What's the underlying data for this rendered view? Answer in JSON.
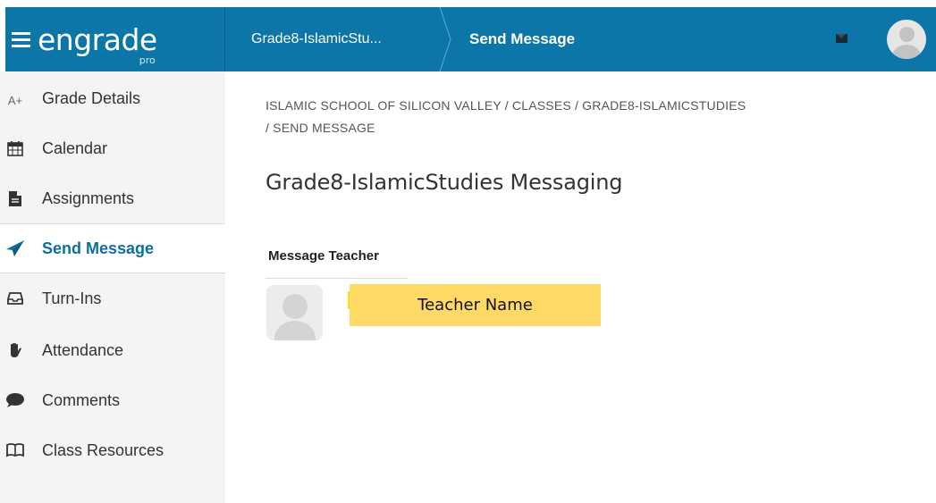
{
  "app": {
    "logo": "engrade",
    "logo_sub": "pro"
  },
  "header": {
    "crumbs": [
      "Grade8-IslamicStu...",
      "Send Message"
    ],
    "icons": {
      "mail": "mail-icon",
      "avatar": "user-avatar-icon"
    },
    "colors": {
      "bar": "#0d76a8"
    }
  },
  "sidebar": {
    "items": [
      {
        "label": "Grade Details",
        "icon": "a-plus-icon"
      },
      {
        "label": "Calendar",
        "icon": "calendar-icon"
      },
      {
        "label": "Assignments",
        "icon": "document-icon"
      },
      {
        "label": "Send Message",
        "icon": "paper-plane-icon",
        "active": true
      },
      {
        "label": "Turn-Ins",
        "icon": "inbox-tray-icon"
      },
      {
        "label": "Attendance",
        "icon": "hand-icon"
      },
      {
        "label": "Comments",
        "icon": "speech-bubble-icon"
      },
      {
        "label": "Class Resources",
        "icon": "book-icon"
      }
    ],
    "active_color": "#0d6fa0"
  },
  "main": {
    "breadcrumb": "ISLAMIC SCHOOL OF SILICON VALLEY  /  CLASSES  /  GRADE8-ISLAMICSTUDIES  /  SEND MESSAGE",
    "title": "Grade8-IslamicStudies Messaging",
    "section_label": "Message Teacher",
    "teacher_name": "Teacher Name",
    "highlight_color": "#ffd966"
  }
}
